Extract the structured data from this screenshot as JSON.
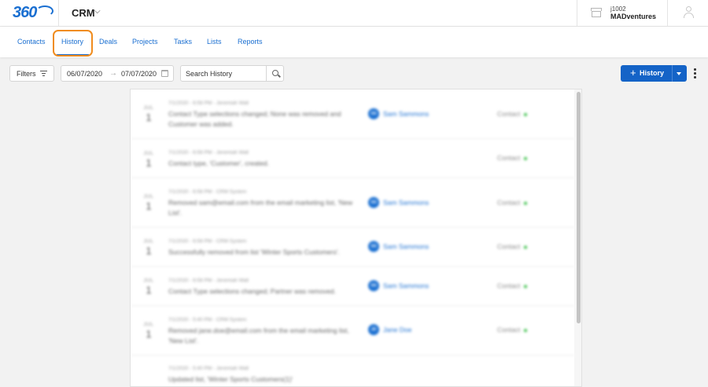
{
  "header": {
    "logo_text": "360",
    "app_name": "CRM",
    "account_id": "j1002",
    "account_name": "MADventures"
  },
  "tabs": [
    {
      "label": "Contacts"
    },
    {
      "label": "History",
      "active": true
    },
    {
      "label": "Deals"
    },
    {
      "label": "Projects"
    },
    {
      "label": "Tasks"
    },
    {
      "label": "Lists"
    },
    {
      "label": "Reports"
    }
  ],
  "toolbar": {
    "filters_label": "Filters",
    "date_start": "06/07/2020",
    "date_end": "07/07/2020",
    "search_placeholder": "Search History",
    "add_history_label": "History"
  },
  "history": [
    {
      "month": "JUL",
      "day": "1",
      "meta": "7/1/2020 - 6:58 PM - Jeremiah Wall",
      "desc": "Contact Type selections changed; None was removed and Customer was added.",
      "person_initials": "SS",
      "person": "Sam Sammons",
      "type": "Contact"
    },
    {
      "month": "JUL",
      "day": "1",
      "meta": "7/1/2020 - 6:58 PM - Jeremiah Wall",
      "desc": "Contact type, 'Customer', created.",
      "person_initials": "",
      "person": "",
      "type": "Contact"
    },
    {
      "month": "JUL",
      "day": "1",
      "meta": "7/1/2020 - 6:58 PM - CRM System",
      "desc": "Removed sam@email.com from the email marketing list, 'New List'.",
      "person_initials": "SS",
      "person": "Sam Sammons",
      "type": "Contact"
    },
    {
      "month": "JUL",
      "day": "1",
      "meta": "7/1/2020 - 6:58 PM - CRM System",
      "desc": "Successfully removed from list 'Winter Sports Customers'.",
      "person_initials": "SS",
      "person": "Sam Sammons",
      "type": "Contact"
    },
    {
      "month": "JUL",
      "day": "1",
      "meta": "7/1/2020 - 6:58 PM - Jeremiah Wall",
      "desc": "Contact Type selections changed; Partner was removed.",
      "person_initials": "SS",
      "person": "Sam Sammons",
      "type": "Contact"
    },
    {
      "month": "JUL",
      "day": "1",
      "meta": "7/1/2020 - 5:40 PM - CRM System",
      "desc": "Removed jane.doe@email.com from the email marketing list, 'New List'.",
      "person_initials": "JD",
      "person": "Jane Doe",
      "type": "Contact"
    },
    {
      "month": "",
      "day": "",
      "meta": "7/1/2020 - 5:40 PM - Jeremiah Wall",
      "desc": "Updated list, 'Winter Sports Customers(1)'",
      "person_initials": "",
      "person": "",
      "type": ""
    }
  ],
  "colors": {
    "brand_blue": "#1a6fd1",
    "button_blue": "#1463c7",
    "highlight_orange": "#f08c1e",
    "status_green": "#3cc04a"
  },
  "icons": [
    "store-icon",
    "user-icon",
    "chevron-down-icon",
    "filter-icon",
    "arrow-right-icon",
    "calendar-icon",
    "search-icon",
    "plus-icon",
    "caret-down-icon",
    "more-vertical-icon"
  ]
}
